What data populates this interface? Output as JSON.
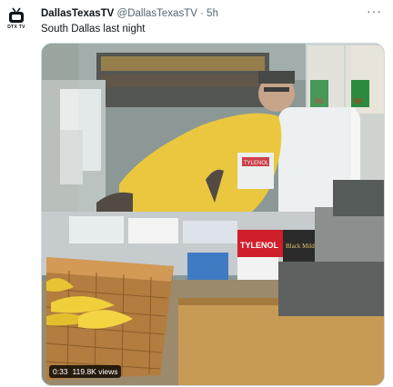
{
  "tweet": {
    "author_name": "DallasTexasTV",
    "author_handle": "@DallasTexasTV",
    "separator": "·",
    "time_ago": "5h",
    "text": "South Dallas last night",
    "avatar_label": "DTX TV"
  },
  "video": {
    "duration": "0:33",
    "views": "119.8K views",
    "product_labels": {
      "tylenol_1": "TYLENOL",
      "tylenol_2": "TYLENOL",
      "black_mild": "Black Mild",
      "price_1": "99",
      "price_2": "99"
    }
  },
  "icons": {
    "more": "more-options-icon",
    "avatar": "tv-logo-icon"
  }
}
